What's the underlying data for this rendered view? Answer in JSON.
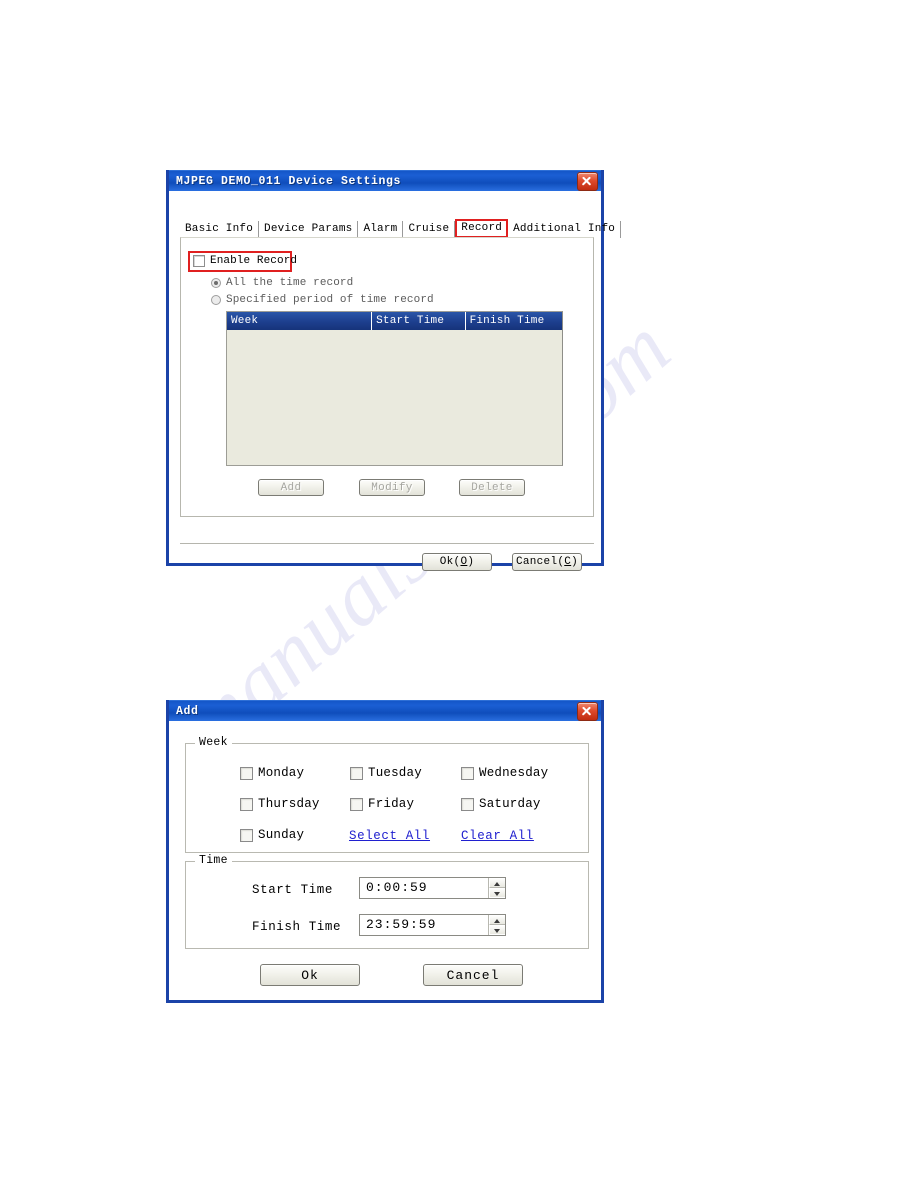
{
  "watermark": {
    "text": "manualshive.com"
  },
  "device_settings_dialog": {
    "title": "MJPEG DEMO_011 Device Settings",
    "close_label": "x",
    "tabs": [
      {
        "label": "Basic Info",
        "active": false
      },
      {
        "label": "Device Params",
        "active": false
      },
      {
        "label": "Alarm",
        "active": false
      },
      {
        "label": "Cruise",
        "active": false
      },
      {
        "label": "Record",
        "active": true
      },
      {
        "label": "Additional Info",
        "active": false
      }
    ],
    "enable_record": {
      "label": "Enable Record",
      "checked": false
    },
    "record_mode": {
      "options": [
        {
          "label": "All the time record",
          "selected": true
        },
        {
          "label": "Specified period of time record",
          "selected": false
        }
      ]
    },
    "schedule_table": {
      "columns": [
        "Week",
        "Start Time",
        "Finish Time"
      ],
      "rows": []
    },
    "list_buttons": {
      "add": "Add",
      "modify": "Modify",
      "delete": "Delete"
    },
    "footer_buttons": {
      "ok": "Ok(O)",
      "ok_text": "Ok(",
      "ok_accel": "O",
      "ok_tail": ")",
      "cancel_text": "Cancel(",
      "cancel_accel": "C",
      "cancel_tail": ")"
    }
  },
  "add_dialog": {
    "title": "Add",
    "close_label": "x",
    "week_group": {
      "legend": "Week",
      "days": [
        {
          "label": "Monday",
          "checked": false
        },
        {
          "label": "Tuesday",
          "checked": false
        },
        {
          "label": "Wednesday",
          "checked": false
        },
        {
          "label": "Thursday",
          "checked": false
        },
        {
          "label": "Friday",
          "checked": false
        },
        {
          "label": "Saturday",
          "checked": false
        },
        {
          "label": "Sunday",
          "checked": false
        }
      ],
      "select_all": "Select All",
      "clear_all": "Clear All"
    },
    "time_group": {
      "legend": "Time",
      "start_label": "Start Time",
      "start_value": "0:00:59",
      "finish_label": "Finish Time",
      "finish_value": "23:59:59"
    },
    "footer_buttons": {
      "ok": "Ok",
      "cancel": "Cancel"
    }
  },
  "colors": {
    "titlebar_blue": "#1456c8",
    "dialog_border": "#1b43a8",
    "highlight_red": "#e02020",
    "list_header": "#1d3f8e",
    "list_body": "#eaeade",
    "link_blue": "#2020cf"
  }
}
